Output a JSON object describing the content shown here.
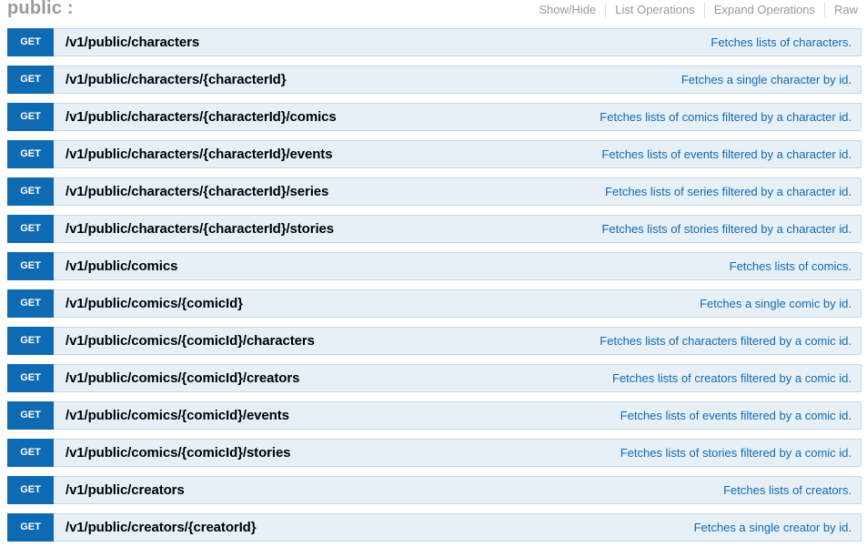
{
  "resource": {
    "title": "public :",
    "links": [
      {
        "label": "Show/Hide"
      },
      {
        "label": "List Operations"
      },
      {
        "label": "Expand Operations"
      },
      {
        "label": "Raw"
      }
    ]
  },
  "colors": {
    "method_bg": "#0f6ab4",
    "row_bg": "#e7f0f7",
    "row_border": "#c3d9ec",
    "summary_text": "#0f6ab4",
    "header_text": "#999999"
  },
  "operations": [
    {
      "method": "GET",
      "path": "/v1/public/characters",
      "summary": "Fetches lists of characters."
    },
    {
      "method": "GET",
      "path": "/v1/public/characters/{characterId}",
      "summary": "Fetches a single character by id."
    },
    {
      "method": "GET",
      "path": "/v1/public/characters/{characterId}/comics",
      "summary": "Fetches lists of comics filtered by a character id."
    },
    {
      "method": "GET",
      "path": "/v1/public/characters/{characterId}/events",
      "summary": "Fetches lists of events filtered by a character id."
    },
    {
      "method": "GET",
      "path": "/v1/public/characters/{characterId}/series",
      "summary": "Fetches lists of series filtered by a character id."
    },
    {
      "method": "GET",
      "path": "/v1/public/characters/{characterId}/stories",
      "summary": "Fetches lists of stories filtered by a character id."
    },
    {
      "method": "GET",
      "path": "/v1/public/comics",
      "summary": "Fetches lists of comics."
    },
    {
      "method": "GET",
      "path": "/v1/public/comics/{comicId}",
      "summary": "Fetches a single comic by id."
    },
    {
      "method": "GET",
      "path": "/v1/public/comics/{comicId}/characters",
      "summary": "Fetches lists of characters filtered by a comic id."
    },
    {
      "method": "GET",
      "path": "/v1/public/comics/{comicId}/creators",
      "summary": "Fetches lists of creators filtered by a comic id."
    },
    {
      "method": "GET",
      "path": "/v1/public/comics/{comicId}/events",
      "summary": "Fetches lists of events filtered by a comic id."
    },
    {
      "method": "GET",
      "path": "/v1/public/comics/{comicId}/stories",
      "summary": "Fetches lists of stories filtered by a comic id."
    },
    {
      "method": "GET",
      "path": "/v1/public/creators",
      "summary": "Fetches lists of creators."
    },
    {
      "method": "GET",
      "path": "/v1/public/creators/{creatorId}",
      "summary": "Fetches a single creator by id."
    }
  ]
}
